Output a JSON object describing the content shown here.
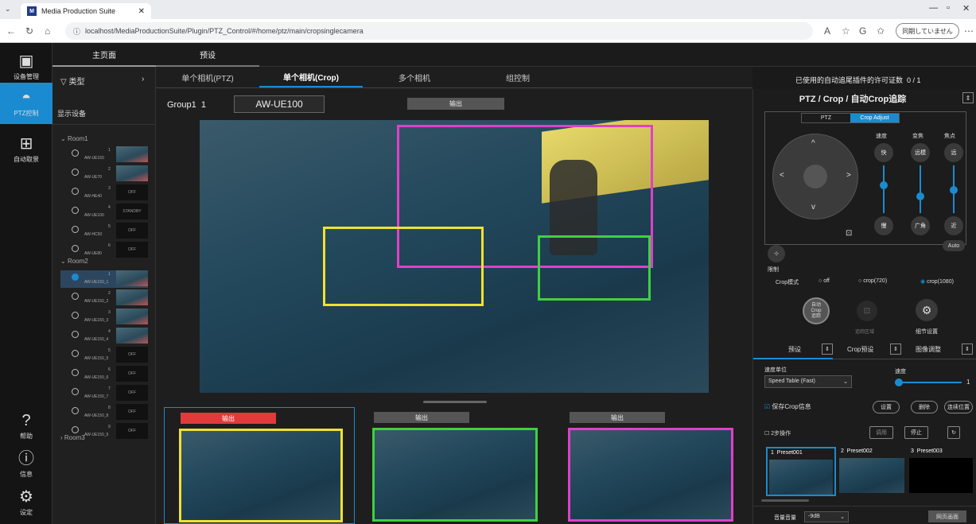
{
  "browser": {
    "tab_title": "Media Production Suite",
    "url": "localhost/MediaProductionSuite/Plugin/PTZ_Control/#/home/ptz/main/cropsinglecamera",
    "signin_label": "同期していません"
  },
  "rail": {
    "items": [
      {
        "label": "设备管理",
        "icon": "device-manage-icon"
      },
      {
        "label": "PTZ控制",
        "icon": "ptz-camera-icon"
      },
      {
        "label": "自动取景",
        "icon": "auto-frame-icon"
      },
      {
        "label": "帮助",
        "icon": "help-icon"
      },
      {
        "label": "信息",
        "icon": "info-icon"
      },
      {
        "label": "设定",
        "icon": "gear-icon"
      }
    ]
  },
  "top_tabs": {
    "main": "主页面",
    "preset": "预设"
  },
  "device_panel": {
    "filter_label": "类型",
    "display_label": "显示设备",
    "rooms": [
      {
        "name": "Room1",
        "cams": [
          {
            "num": "1",
            "name": "AW-UE150",
            "thumb": ""
          },
          {
            "num": "2",
            "name": "AW-UE70",
            "thumb": ""
          },
          {
            "num": "3",
            "name": "AW-HE40",
            "thumb": "OFF"
          },
          {
            "num": "4",
            "name": "AW-UE100",
            "thumb": "STANDBY"
          },
          {
            "num": "5",
            "name": "AW-HC50",
            "thumb": "OFF"
          },
          {
            "num": "6",
            "name": "AW-UE80",
            "thumb": "OFF"
          }
        ]
      },
      {
        "name": "Room2",
        "cams": [
          {
            "num": "1",
            "name": "AW-UE150_1",
            "thumb": ""
          },
          {
            "num": "2",
            "name": "AW-UE150_2",
            "thumb": ""
          },
          {
            "num": "3",
            "name": "AW-UE150_3",
            "thumb": ""
          },
          {
            "num": "4",
            "name": "AW-UE150_4",
            "thumb": ""
          },
          {
            "num": "5",
            "name": "AW-UE150_5",
            "thumb": "OFF"
          },
          {
            "num": "6",
            "name": "AW-UE150_6",
            "thumb": "OFF"
          },
          {
            "num": "7",
            "name": "AW-UE150_7",
            "thumb": "OFF"
          },
          {
            "num": "8",
            "name": "AW-UE150_8",
            "thumb": "OFF"
          },
          {
            "num": "9",
            "name": "AW-UE150_9",
            "thumb": "OFF"
          }
        ]
      },
      {
        "name": "Room3",
        "cams": []
      }
    ]
  },
  "main": {
    "tabs": [
      "单个相机(PTZ)",
      "单个相机(Crop)",
      "多个相机",
      "组控制"
    ],
    "license_text": "已使用的自动追尾插件的许可证数",
    "license_value": "0 / 1",
    "group_label": "Group1",
    "group_num": "1",
    "camera_name": "AW-UE100",
    "output_label": "输出",
    "crop_outputs": [
      "输出",
      "输出",
      "输出"
    ]
  },
  "right": {
    "mode_title": "PTZ / Crop / 自动Crop追踪",
    "tabs": [
      "PTZ",
      "Crop Adjust"
    ],
    "speed_label": "速度",
    "zoom_label": "变焦",
    "focus_label": "焦点",
    "fast": "快",
    "slow": "慢",
    "tele": "远模",
    "wide": "广角",
    "far": "远",
    "near": "近",
    "auto": "Auto",
    "limit_label": "限制",
    "crop_mode_label": "Crop模式",
    "crop_options": [
      "off",
      "crop(720)",
      "crop(1080)"
    ],
    "auto_crop_label": "自动\nCrop\n追踪",
    "tracking_area_label": "追踪区域",
    "detail_settings_label": "细节设置",
    "bottom_tabs": [
      "预设",
      "Crop预设",
      "图像调整"
    ],
    "speed_unit_label": "速度单位",
    "speed_label2": "速度",
    "speed_table": "Speed Table (Fast)",
    "speed_value": "1",
    "save_crop_label": "保存Crop信息",
    "btn_save": "设置",
    "btn_delete": "删除",
    "btn_continuous": "连续位置",
    "two_step_label": "2步操作",
    "btn_call": "调用",
    "btn_stop": "停止",
    "presets": [
      {
        "num": "1",
        "name": "Preset001"
      },
      {
        "num": "2",
        "name": "Preset002"
      },
      {
        "num": "3",
        "name": "Preset003"
      }
    ],
    "volume_label": "音量音量",
    "volume_value": "-9dB",
    "multiview_button": "网页画面"
  }
}
